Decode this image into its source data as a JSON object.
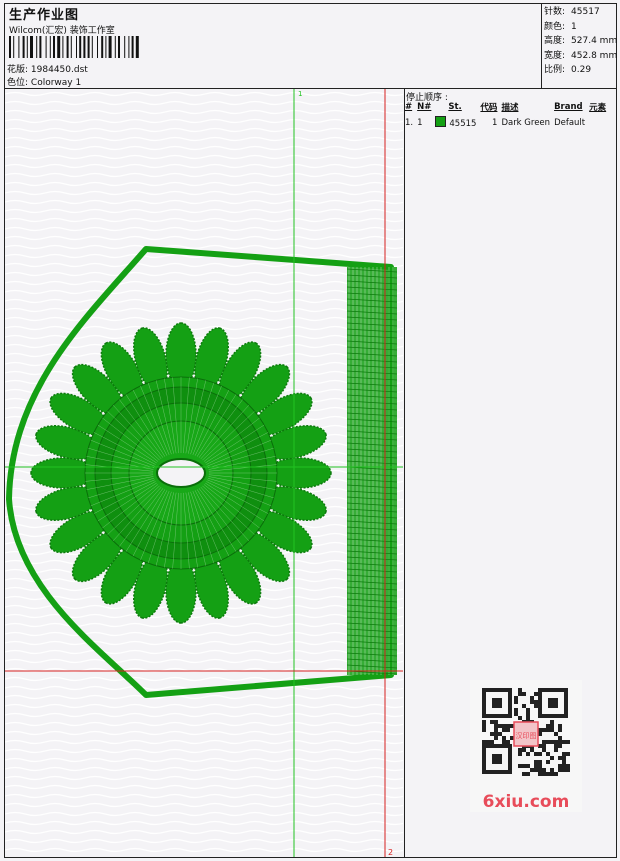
{
  "header": {
    "title": "生产作业图",
    "company": "Wilcom(汇宏) 装饰工作室",
    "design_label": "花版:",
    "design_value": "1984450.dst",
    "colorway_label": "色位:",
    "colorway_value": "Colorway 1"
  },
  "stats": [
    {
      "label": "针数:",
      "value": "45517"
    },
    {
      "label": "颜色:",
      "value": "1"
    },
    {
      "label": "高度:",
      "value": "527.4 mm"
    },
    {
      "label": "宽度:",
      "value": "452.8 mm"
    },
    {
      "label": "比例:",
      "value": "0.29"
    }
  ],
  "stop_sequence": {
    "title": "停止顺序 :",
    "columns": [
      "#",
      "N#",
      "St.",
      "代码",
      "描述",
      "Brand",
      "元素"
    ],
    "rows": [
      {
        "index": "1.",
        "n": "1",
        "stitches": "45515",
        "code": "1",
        "description": "Dark Green",
        "brand": "Default",
        "color": "#14a014"
      }
    ]
  },
  "guides": {
    "vertical_marker": "1",
    "bottom_marker": "2"
  },
  "watermark": {
    "text": "6xiu.com",
    "seal_text": "汉印图",
    "color": "#e84c5a"
  },
  "colors": {
    "stitch": "#14a014",
    "guide_green": "#22c322",
    "guide_red": "#d62020",
    "border": "#222222"
  }
}
